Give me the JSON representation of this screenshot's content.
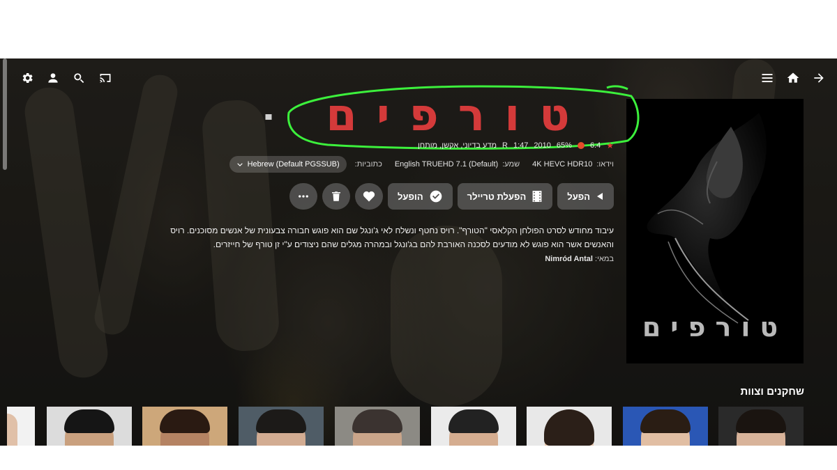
{
  "header": {
    "left_icons": [
      "settings-icon",
      "user-icon",
      "search-icon",
      "cast-icon"
    ],
    "right_icons": [
      "menu-icon",
      "home-icon",
      "back-arrow-icon"
    ]
  },
  "movie": {
    "logo_text": "טורפים",
    "poster_title": "טורפים",
    "rating": "6.4",
    "critic_score": "65%",
    "year": "2010",
    "runtime": "1:47",
    "age_rating": "R",
    "genres": "מדע בדיוני, אקשן, מותחן",
    "video_label": "וידאו:",
    "video_value": "4K HEVC HDR10",
    "audio_label": "שמע:",
    "audio_value": "English TRUEHD 7.1 (Default)",
    "subtitles_label": "כתוביות:",
    "subtitles_value": "Hebrew (Default PGSSUB)",
    "overview": "עיבוד מחודש לסרט הפולחן הקלאסי \"הטורף\". רויס נחטף ונשלח לאי ג'ונגל שם הוא פוגש חבורה צבעונית של אנשים מסוכנים. רויס והאנשים אשר הוא פוגש לא מודעים לסכנה האורבת להם בג'ונגל ובמהרה מגלים שהם ניצודים ע\"י זן טורף של חייזרים.",
    "director_label": "במאי:",
    "director_name": "Nimród Antal"
  },
  "actions": {
    "play": "הפעל",
    "trailer": "הפעלת טריילר",
    "played": "הופעל"
  },
  "cast": {
    "title": "שחקנים וצוות"
  },
  "colors": {
    "logo_red": "#d43a3a",
    "annotation_green": "#3cf03c",
    "button_bg": "#787878"
  }
}
